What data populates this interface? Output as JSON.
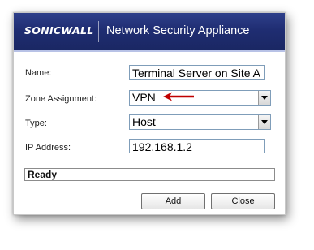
{
  "header": {
    "logo_text": "SONICWALL",
    "title": "Network Security Appliance",
    "banner_color": "#1f2d72"
  },
  "form": {
    "name_label": "Name:",
    "name_value": "Terminal Server on Site A",
    "zone_label": "Zone Assignment:",
    "zone_value": "VPN",
    "type_label": "Type:",
    "type_value": "Host",
    "ip_label": "IP Address:",
    "ip_value": "192.168.1.2"
  },
  "annotation": {
    "arrow_color": "#c00000",
    "points_to": "zone-select"
  },
  "status": {
    "text": "Ready"
  },
  "buttons": {
    "add_label": "Add",
    "close_label": "Close"
  }
}
